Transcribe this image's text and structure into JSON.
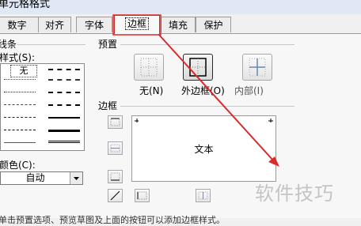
{
  "window": {
    "title": "单元格格式"
  },
  "tabs": [
    {
      "label": "数字"
    },
    {
      "label": "对齐"
    },
    {
      "label": "字体"
    },
    {
      "label": "边框",
      "active": true
    },
    {
      "label": "填充"
    },
    {
      "label": "保护"
    }
  ],
  "line_group": {
    "title": "线条",
    "style_label": "样式(S):",
    "none_label": "无",
    "color_label": "颜色(C):",
    "color_value": "自动"
  },
  "presets": {
    "title": "预置",
    "items": [
      {
        "label": "无(N)"
      },
      {
        "label": "外边框(O)"
      },
      {
        "label": "内部(I)"
      }
    ]
  },
  "border": {
    "title": "边框",
    "preview_text": "文本"
  },
  "footer_text": "单击预置选项、预览草图及上面的按钮可以添加边框样式。",
  "watermark": "软件技巧",
  "annotation": {
    "color": "#d92b2b"
  }
}
